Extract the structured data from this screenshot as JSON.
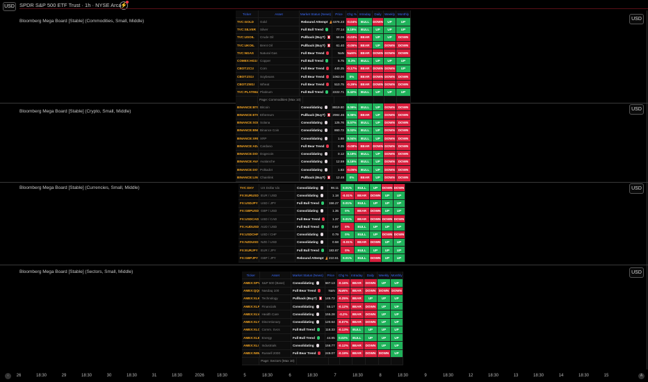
{
  "header": {
    "currency": "USD",
    "title": "SPDR S&P 500 ETF Trust · 1h · NYSE Arca"
  },
  "columns": [
    "Ticker",
    "Asset",
    "Market Status (News)",
    "Price",
    "Chg %",
    "Intraday",
    "Daily",
    "Weekly",
    "Monthly"
  ],
  "colors": {
    "green": "#1fb25a",
    "red": "#d81e3c",
    "ticker": "#f5a623",
    "header": "#3b6cff"
  },
  "panes": [
    {
      "title": "Bloomberg Mega Board [Stable] (Commodities, Small, Middle)",
      "currency": "USD",
      "show_header": true,
      "footer": "Page: Commodities (Max 10)",
      "rows": [
        [
          "TVC:GOLD",
          "Gold",
          "Rebound Attempt",
          "reb",
          "4376.23",
          "-0.04%",
          "r",
          "BULL",
          "DOWN",
          "UP",
          "UP"
        ],
        [
          "TVC:SILVER",
          "Silver",
          "Full Bull Trend",
          "bull",
          "77.14",
          "0.19%",
          "g",
          "BULL",
          "UP",
          "UP",
          "UP"
        ],
        [
          "TVC:USOIL",
          "Crude Oil",
          "Pullback (Buy?)",
          "pull",
          "58.06",
          "-0.03%",
          "r",
          "BEAR",
          "UP",
          "UP",
          "DOWN"
        ],
        [
          "TVC:UKOIL",
          "Brent Oil",
          "Pullback (Buy?)",
          "pull",
          "61.40",
          "-0.05%",
          "r",
          "BEAR",
          "UP",
          "DOWN",
          "DOWN"
        ],
        [
          "TVC:NGAS",
          "Natural Gas",
          "Full Bear Trend",
          "bear",
          "NaN",
          "NaN%",
          "r",
          "BEAR",
          "DOWN",
          "DOWN",
          "DOWN"
        ],
        [
          "COMEX:HG1!",
          "Copper",
          "Full Bull Trend",
          "bull",
          "5.75",
          "0.3%",
          "g",
          "BULL",
          "UP",
          "UP",
          "UP"
        ],
        [
          "CBOT:ZC1!",
          "Corn",
          "Full Bear Trend",
          "bear",
          "440.25",
          "-0.17%",
          "r",
          "BEAR",
          "DOWN",
          "DOWN",
          "UP"
        ],
        [
          "CBOT:ZS1!",
          "Soybeans",
          "Full Bear Trend",
          "bear",
          "1063.00",
          "0%",
          "g",
          "BEAR",
          "DOWN",
          "DOWN",
          "DOWN"
        ],
        [
          "CBOT:ZW1!",
          "Wheat",
          "Full Bear Trend",
          "bear",
          "510.75",
          "-0.29%",
          "r",
          "BEAR",
          "DOWN",
          "DOWN",
          "DOWN"
        ],
        [
          "TVC:PLATINUM",
          "Platinum",
          "Full Bull Trend",
          "bull",
          "2222.71",
          "0.42%",
          "g",
          "BULL",
          "UP",
          "UP",
          "UP"
        ]
      ]
    },
    {
      "title": "Bloomberg Mega Board [Stable] (Crypto, Small, Middle)",
      "currency": "USD",
      "show_header": false,
      "footer": null,
      "rows": [
        [
          "BINANCE:BTCUSDT",
          "Bitcoin",
          "Consolidating",
          "cons",
          "88819.80",
          "0.09%",
          "g",
          "BULL",
          "UP",
          "DOWN",
          "DOWN"
        ],
        [
          "BINANCE:ETHUSDT",
          "Ethereum",
          "Pullback (Buy?)",
          "pull",
          "2984.46",
          "0.06%",
          "g",
          "BEAR",
          "UP",
          "DOWN",
          "DOWN"
        ],
        [
          "BINANCE:SOLUSDT",
          "Solana",
          "Consolidating",
          "cons",
          "125.76",
          "0.07%",
          "g",
          "BULL",
          "UP",
          "DOWN",
          "DOWN"
        ],
        [
          "BINANCE:BNBUSDT",
          "Binance Coin",
          "Consolidating",
          "cons",
          "860.72",
          "0.03%",
          "g",
          "BULL",
          "UP",
          "DOWN",
          "DOWN"
        ],
        [
          "BINANCE:XRPUSDT",
          "XRP",
          "Consolidating",
          "cons",
          "1.88",
          "0.04%",
          "g",
          "BULL",
          "UP",
          "DOWN",
          "DOWN"
        ],
        [
          "BINANCE:ADAUSDT",
          "Cardano",
          "Full Bear Trend",
          "bear",
          "0.35",
          "-0.08%",
          "r",
          "BEAR",
          "DOWN",
          "DOWN",
          "DOWN"
        ],
        [
          "BINANCE:DOGEUSDT",
          "Dogecoin",
          "Consolidating",
          "cons",
          "0.12",
          "0.19%",
          "g",
          "BULL",
          "UP",
          "DOWN",
          "DOWN"
        ],
        [
          "BINANCE:AVAXUSDT",
          "Avalanche",
          "Consolidating",
          "cons",
          "12.59",
          "0.16%",
          "g",
          "BULL",
          "UP",
          "DOWN",
          "DOWN"
        ],
        [
          "BINANCE:DOTUSDT",
          "Polkadot",
          "Consolidating",
          "cons",
          "1.83",
          "-0.05%",
          "r",
          "BULL",
          "UP",
          "DOWN",
          "DOWN"
        ],
        [
          "BINANCE:LINKUSDT",
          "Chainlink",
          "Pullback (Buy?)",
          "pull",
          "12.48",
          "0%",
          "g",
          "BEAR",
          "UP",
          "DOWN",
          "DOWN"
        ]
      ]
    },
    {
      "title": "Bloomberg Mega Board [Stable] (Currencies, Small, Middle)",
      "currency": "USD",
      "show_header": false,
      "footer": null,
      "rows": [
        [
          "TVC:DXY",
          "US Dollar Idx",
          "Consolidating",
          "cons",
          "98.11",
          "0.01%",
          "g",
          "BULL",
          "UP",
          "DOWN",
          "DOWN"
        ],
        [
          "FX:EURUSD",
          "EUR / USD",
          "Consolidating",
          "cons",
          "1.18",
          "-0.01%",
          "r",
          "BEAR",
          "DOWN",
          "UP",
          "UP"
        ],
        [
          "FX:USDJPY",
          "USD / JPY",
          "Full Bull Trend",
          "bull",
          "156.27",
          "0.01%",
          "g",
          "BULL",
          "UP",
          "UP",
          "UP"
        ],
        [
          "FX:GBPUSD",
          "GBP / USD",
          "Consolidating",
          "cons",
          "1.35",
          "0%",
          "g",
          "BEAR",
          "DOWN",
          "UP",
          "UP"
        ],
        [
          "FX:USDCAD",
          "USD / CAD",
          "Full Bear Trend",
          "bear",
          "1.37",
          "0.01%",
          "g",
          "BEAR",
          "DOWN",
          "DOWN",
          "DOWN"
        ],
        [
          "FX:AUDUSD",
          "AUD / USD",
          "Full Bull Trend",
          "bull",
          "0.67",
          "0%",
          "r",
          "BULL",
          "UP",
          "UP",
          "UP"
        ],
        [
          "FX:USDCHF",
          "USD / CHF",
          "Consolidating",
          "cons",
          "0.79",
          "0%",
          "g",
          "BULL",
          "UP",
          "DOWN",
          "DOWN"
        ],
        [
          "FX:NZDUSD",
          "NZD / USD",
          "Consolidating",
          "cons",
          "0.58",
          "-0.01%",
          "r",
          "BEAR",
          "DOWN",
          "UP",
          "UP"
        ],
        [
          "FX:EURJPY",
          "EUR / JPY",
          "Full Bull Trend",
          "bull",
          "183.87",
          "0%",
          "r",
          "BULL",
          "UP",
          "UP",
          "UP"
        ],
        [
          "FX:GBPJPY",
          "GBP / JPY",
          "Rebound Attempt",
          "reb",
          "210.61",
          "0.01%",
          "g",
          "BULL",
          "DOWN",
          "UP",
          "UP"
        ]
      ]
    },
    {
      "title": "Bloomberg Mega Board [Stable] (Sectors, Small, Middle)",
      "currency": "USD",
      "show_header": true,
      "footer": "Page: Sectors (Max 10)",
      "rows": [
        [
          "AMEX:SPY",
          "S&P 500 (Base)",
          "Consolidating",
          "cons",
          "687.13",
          "-0.16%",
          "r",
          "BEAR",
          "DOWN",
          "UP",
          "UP"
        ],
        [
          "AMEX:QQQ",
          "Nasdaq 100",
          "Full Bear Trend",
          "bear",
          "NaN",
          "NaN%",
          "r",
          "BEAR",
          "DOWN",
          "DOWN",
          "DOWN"
        ],
        [
          "AMEX:XLK",
          "Technology",
          "Pullback (Buy?)",
          "pull",
          "145.72",
          "-0.25%",
          "r",
          "BEAR",
          "UP",
          "UP",
          "UP"
        ],
        [
          "AMEX:XLF",
          "Financials",
          "Consolidating",
          "cons",
          "55.17",
          "-0.12%",
          "r",
          "BEAR",
          "DOWN",
          "UP",
          "UP"
        ],
        [
          "AMEX:XLV",
          "Health Care",
          "Consolidating",
          "cons",
          "155.28",
          "-0.2%",
          "r",
          "BEAR",
          "DOWN",
          "UP",
          "UP"
        ],
        [
          "AMEX:XLY",
          "Discretionary",
          "Consolidating",
          "cons",
          "120.64",
          "-0.07%",
          "r",
          "BEAR",
          "DOWN",
          "UP",
          "UP"
        ],
        [
          "AMEX:XLC",
          "Comm. Svcs",
          "Full Bull Trend",
          "bull",
          "118.33",
          "-0.13%",
          "r",
          "BULL",
          "UP",
          "UP",
          "UP"
        ],
        [
          "AMEX:XLE",
          "Energy",
          "Full Bull Trend",
          "bull",
          "44.85",
          "0.02%",
          "g",
          "BULL",
          "UP",
          "UP",
          "UP"
        ],
        [
          "AMEX:XLI",
          "Industrials",
          "Consolidating",
          "cons",
          "156.77",
          "-0.12%",
          "r",
          "BEAR",
          "DOWN",
          "UP",
          "UP"
        ],
        [
          "AMEX:IWM",
          "Russell 2000",
          "Full Bear Trend",
          "bear",
          "249.07",
          "-0.19%",
          "r",
          "BEAR",
          "DOWN",
          "DOWN",
          "UP"
        ]
      ]
    }
  ],
  "time_axis": [
    "26",
    "18:30",
    "29",
    "18:30",
    "30",
    "18:30",
    "31",
    "18:30",
    "2026",
    "18:30",
    "5",
    "18:30",
    "6",
    "18:30",
    "7",
    "18:30",
    "8",
    "18:30",
    "9",
    "18:30",
    "12",
    "18:30",
    "13",
    "18:30",
    "14",
    "18:30",
    "15"
  ]
}
